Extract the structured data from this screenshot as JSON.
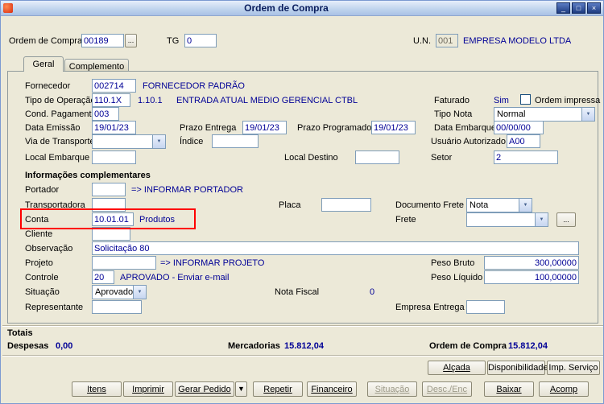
{
  "colors": {
    "navy": "#000096",
    "highlight_red": "#ff0000",
    "titlebar_text": "#0a1e5e"
  },
  "icons": {
    "minimize": "_",
    "maximize": "□",
    "close": "×",
    "dropdown": "▼",
    "ellipsis": "..."
  },
  "window": {
    "title": "Ordem de Compra"
  },
  "header": {
    "ordem_label": "Ordem de Compra",
    "ordem_value": "00189",
    "tg_label": "TG",
    "tg_value": "0",
    "un_label": "U.N.",
    "un_value": "001",
    "un_company": "EMPRESA MODELO LTDA"
  },
  "tabs": [
    {
      "label": "Geral"
    },
    {
      "label": "Complemento"
    }
  ],
  "geral": {
    "fornecedor": {
      "label": "Fornecedor",
      "value": "002714",
      "desc": "FORNECEDOR PADRÃO"
    },
    "tipo_operacao": {
      "label": "Tipo de Operação",
      "value": "110.1X",
      "code": "1.10.1",
      "desc": "ENTRADA ATUAL MEDIO GERENCIAL CTBL"
    },
    "faturado": {
      "label": "Faturado",
      "value": "Sim"
    },
    "ordem_impressa": {
      "label": "Ordem impressa"
    },
    "cond_pagamento": {
      "label": "Cond. Pagamento",
      "value": "003"
    },
    "tipo_nota": {
      "label": "Tipo Nota",
      "value": "Normal"
    },
    "data_emissao": {
      "label": "Data Emissão",
      "value": "19/01/23"
    },
    "prazo_entrega": {
      "label": "Prazo Entrega",
      "value": "19/01/23"
    },
    "prazo_programado": {
      "label": "Prazo Programado",
      "value": "19/01/23"
    },
    "data_embarque": {
      "label": "Data Embarque",
      "value": "00/00/00"
    },
    "via_transporte": {
      "label": "Via de Transporte",
      "value": ""
    },
    "indice": {
      "label": "Índice",
      "value": ""
    },
    "usuario_autorizado": {
      "label": "Usuário Autorizado",
      "value": "A00"
    },
    "local_embarque": {
      "label": "Local Embarque",
      "value": ""
    },
    "local_destino": {
      "label": "Local Destino",
      "value": ""
    },
    "setor": {
      "label": "Setor",
      "value": "2"
    }
  },
  "comp": {
    "title": "Informações complementares",
    "portador": {
      "label": "Portador",
      "value": "",
      "hint": "=> INFORMAR PORTADOR"
    },
    "transportadora": {
      "label": "Transportadora",
      "value": ""
    },
    "placa": {
      "label": "Placa",
      "value": ""
    },
    "documento_frete": {
      "label": "Documento Frete",
      "value": "Nota"
    },
    "conta": {
      "label": "Conta",
      "value": "10.01.01",
      "desc": "Produtos"
    },
    "frete": {
      "label": "Frete",
      "value": ""
    },
    "cliente": {
      "label": "Cliente",
      "value": ""
    },
    "observacao": {
      "label": "Observação",
      "value": "Solicitação 80"
    },
    "projeto": {
      "label": "Projeto",
      "value": "",
      "hint": "=> INFORMAR PROJETO"
    },
    "peso_bruto": {
      "label": "Peso Bruto",
      "value": "300,00000"
    },
    "controle": {
      "label": "Controle",
      "value": "20",
      "desc": "APROVADO - Enviar e-mail"
    },
    "peso_liquido": {
      "label": "Peso Líquido",
      "value": "100,00000"
    },
    "situacao": {
      "label": "Situação",
      "value": "Aprovado"
    },
    "nota_fiscal": {
      "label": "Nota Fiscal",
      "value": "0"
    },
    "representante": {
      "label": "Representante",
      "value": ""
    },
    "empresa_entrega": {
      "label": "Empresa Entrega",
      "value": ""
    }
  },
  "totais": {
    "title": "Totais",
    "despesas": {
      "label": "Despesas",
      "value": "0,00"
    },
    "mercadorias": {
      "label": "Mercadorias",
      "value": "15.812,04"
    },
    "ordem_compra": {
      "label": "Ordem de Compra",
      "value": "15.812,04"
    }
  },
  "actions": {
    "alcada": "Alçada",
    "disponibilidade": "Disponibilidade",
    "imp_servico": "Imp. Serviço",
    "itens": "Itens",
    "imprimir": "Imprimir",
    "gerar_pedido": "Gerar Pedido",
    "repetir": "Repetir",
    "financeiro": "Financeiro",
    "situacao": "Situação",
    "desc_enc": "Desc./Enc",
    "baixar": "Baixar",
    "acomp": "Acomp"
  }
}
